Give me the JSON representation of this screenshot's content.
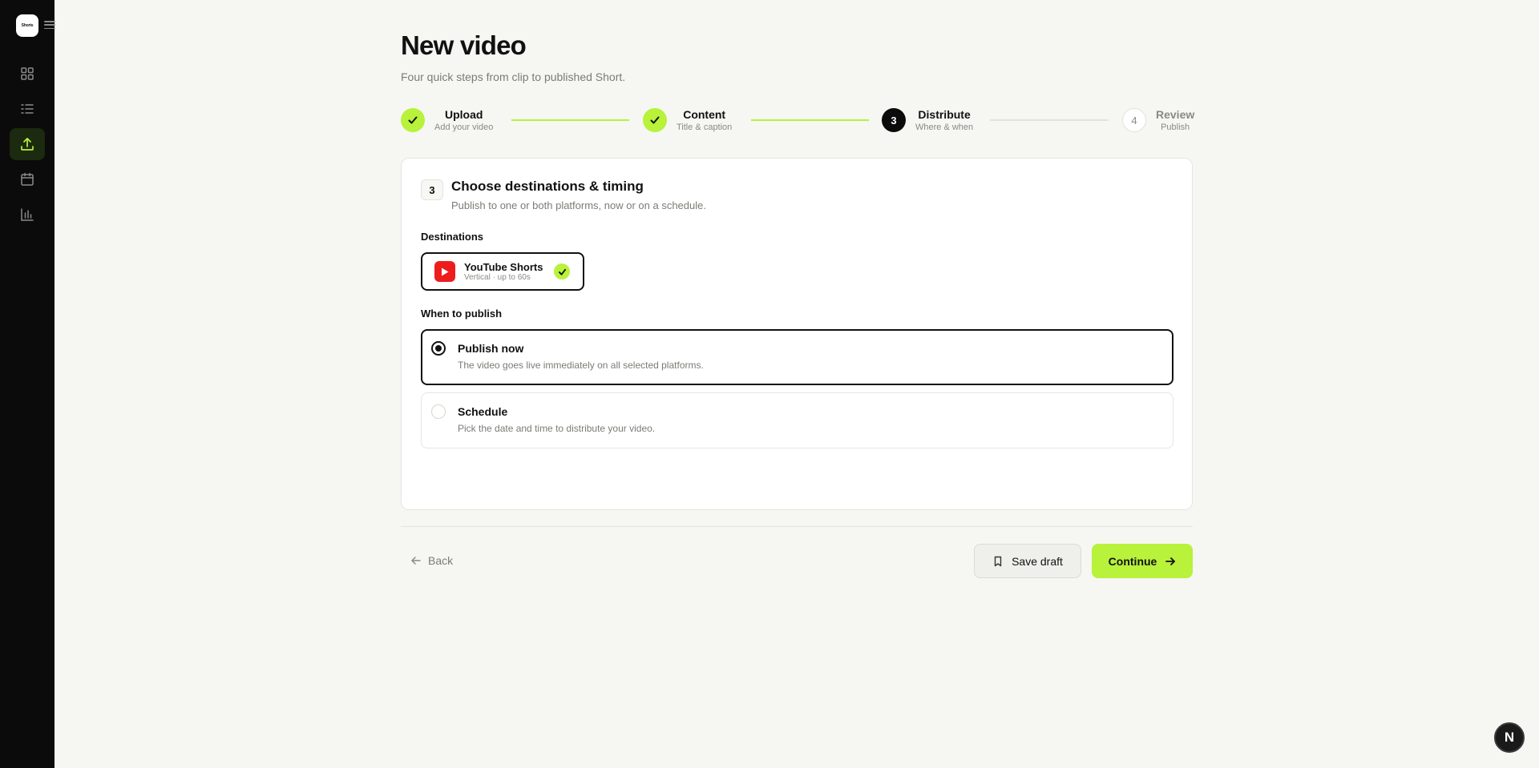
{
  "app": {
    "logo_text": "Shorts"
  },
  "sidebar": {
    "items": [
      {
        "name": "dashboard",
        "icon": "grid-icon",
        "active": false
      },
      {
        "name": "videos",
        "icon": "list-icon",
        "active": false
      },
      {
        "name": "upload",
        "icon": "upload-icon",
        "active": true
      },
      {
        "name": "calendar",
        "icon": "calendar-icon",
        "active": false
      },
      {
        "name": "analytics",
        "icon": "bar-chart-icon",
        "active": false
      }
    ],
    "active_color": "#b8f23a"
  },
  "page": {
    "title": "New video",
    "subtitle": "Four quick steps from clip to published Short."
  },
  "stepper": {
    "steps": [
      {
        "label": "Upload",
        "sub": "Add your video",
        "state": "done",
        "number": "1"
      },
      {
        "label": "Content",
        "sub": "Title & caption",
        "state": "done",
        "number": "2"
      },
      {
        "label": "Distribute",
        "sub": "Where & when",
        "state": "current",
        "number": "3"
      },
      {
        "label": "Review",
        "sub": "Publish",
        "state": "pending",
        "number": "4"
      }
    ]
  },
  "card": {
    "step_number": "3",
    "title": "Choose destinations & timing",
    "subtitle": "Publish to one or both platforms, now or on a schedule.",
    "destinations_label": "Destinations",
    "destinations": [
      {
        "name": "YouTube Shorts",
        "meta": "Vertical · up to 60s",
        "selected": true,
        "icon": "youtube-icon"
      }
    ],
    "when_label": "When to publish",
    "options": [
      {
        "title": "Publish now",
        "desc": "The video goes live immediately on all selected platforms.",
        "selected": true
      },
      {
        "title": "Schedule",
        "desc": "Pick the date and time to distribute your video.",
        "selected": false
      }
    ]
  },
  "footer": {
    "back_label": "Back",
    "save_label": "Save draft",
    "continue_label": "Continue"
  },
  "user": {
    "initial": "N"
  },
  "colors": {
    "accent": "#b8f23a",
    "youtube": "#ee1d1d",
    "dark": "#0b0b0b"
  }
}
